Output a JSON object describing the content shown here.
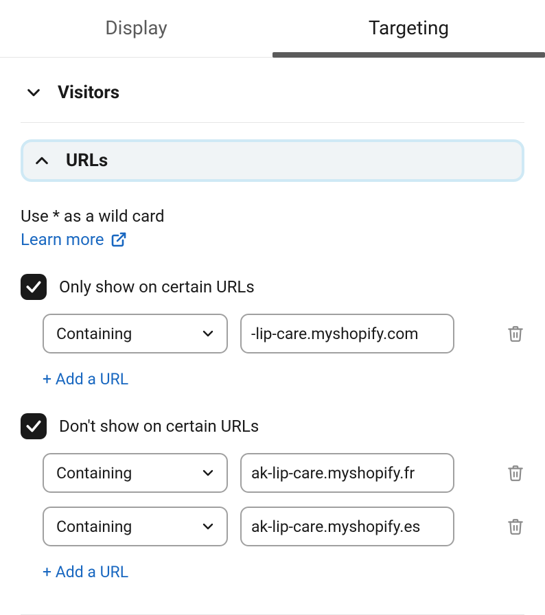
{
  "tabs": {
    "display": "Display",
    "targeting": "Targeting"
  },
  "sections": {
    "visitors": {
      "title": "Visitors"
    },
    "urls": {
      "title": "URLs",
      "help": "Use * as a wild card",
      "learn_more": "Learn more",
      "only_show": {
        "label": "Only show on certain URLs",
        "rules": [
          {
            "op": "Containing",
            "value": "-lip-care.myshopify.com"
          }
        ],
        "add": "+ Add a URL"
      },
      "dont_show": {
        "label": "Don't show on certain URLs",
        "rules": [
          {
            "op": "Containing",
            "value": "ak-lip-care.myshopify.fr"
          },
          {
            "op": "Containing",
            "value": "ak-lip-care.myshopify.es"
          }
        ],
        "add": "+ Add a URL"
      }
    }
  }
}
